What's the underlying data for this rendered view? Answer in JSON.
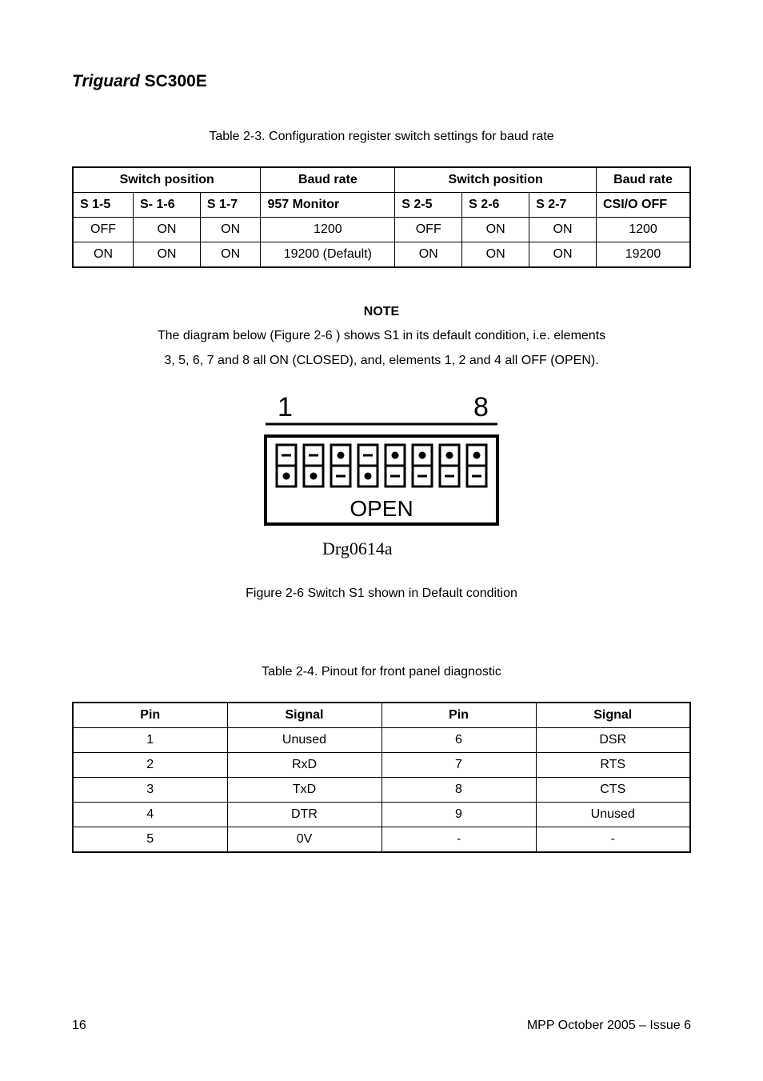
{
  "header": {
    "title_ital": "Triguard",
    "title_bold": " SC300E"
  },
  "table1": {
    "caption": "Table 2-3. Configuration register switch settings for baud rate",
    "head_sp1": "Switch position",
    "head_br1": "Baud rate",
    "head_sp2": "Switch position",
    "head_br2": "Baud rate",
    "sub": [
      "S 1-5",
      "S- 1-6",
      "S 1-7",
      "957 Monitor",
      "S 2-5",
      "S 2-6",
      "S 2-7",
      "CSI/O OFF"
    ],
    "rows": [
      [
        "OFF",
        "ON",
        "ON",
        "1200",
        "OFF",
        "ON",
        "ON",
        "1200"
      ],
      [
        "ON",
        "ON",
        "ON",
        "19200 (Default)",
        "ON",
        "ON",
        "ON",
        "19200"
      ]
    ]
  },
  "note": {
    "label": "NOTE",
    "line1": "The diagram below (Figure 2-6 ) shows S1 in its default condition, i.e. elements",
    "line2": "3, 5, 6, 7 and 8 all ON (CLOSED), and, elements 1, 2 and 4 all OFF (OPEN)."
  },
  "figure": {
    "num_left": "1",
    "num_right": "8",
    "open_text": "OPEN",
    "drg": "Drg0614a",
    "caption": "Figure 2-6 Switch S1 shown in Default condition"
  },
  "table2": {
    "caption": "Table 2-4. Pinout for front panel diagnostic",
    "head": [
      "Pin",
      "Signal",
      "Pin",
      "Signal"
    ],
    "rows": [
      [
        "1",
        "Unused",
        "6",
        "DSR"
      ],
      [
        "2",
        "RxD",
        "7",
        "RTS"
      ],
      [
        "3",
        "TxD",
        "8",
        "CTS"
      ],
      [
        "4",
        "DTR",
        "9",
        "Unused"
      ],
      [
        "5",
        "0V",
        "-",
        "-"
      ]
    ]
  },
  "footer": {
    "left": "16",
    "right": "MPP October 2005 –  Issue 6"
  },
  "chart_data": {
    "type": "table",
    "tables": [
      {
        "title": "Configuration register switch settings for baud rate",
        "columns": [
          "S 1-5",
          "S- 1-6",
          "S 1-7",
          "957 Monitor",
          "S 2-5",
          "S 2-6",
          "S 2-7",
          "CSI/O OFF"
        ],
        "rows": [
          [
            "OFF",
            "ON",
            "ON",
            "1200",
            "OFF",
            "ON",
            "ON",
            "1200"
          ],
          [
            "ON",
            "ON",
            "ON",
            "19200 (Default)",
            "ON",
            "ON",
            "ON",
            "19200"
          ]
        ]
      },
      {
        "title": "Pinout for front panel diagnostic",
        "columns": [
          "Pin",
          "Signal",
          "Pin",
          "Signal"
        ],
        "rows": [
          [
            "1",
            "Unused",
            "6",
            "DSR"
          ],
          [
            "2",
            "RxD",
            "7",
            "RTS"
          ],
          [
            "3",
            "TxD",
            "8",
            "CTS"
          ],
          [
            "4",
            "DTR",
            "9",
            "Unused"
          ],
          [
            "5",
            "0V",
            "-",
            "-"
          ]
        ]
      }
    ],
    "switch_diagram": {
      "label_left": "1",
      "label_right": "8",
      "caption": "OPEN",
      "positions_closed_on": [
        false,
        false,
        true,
        false,
        true,
        true,
        true,
        true
      ]
    }
  }
}
